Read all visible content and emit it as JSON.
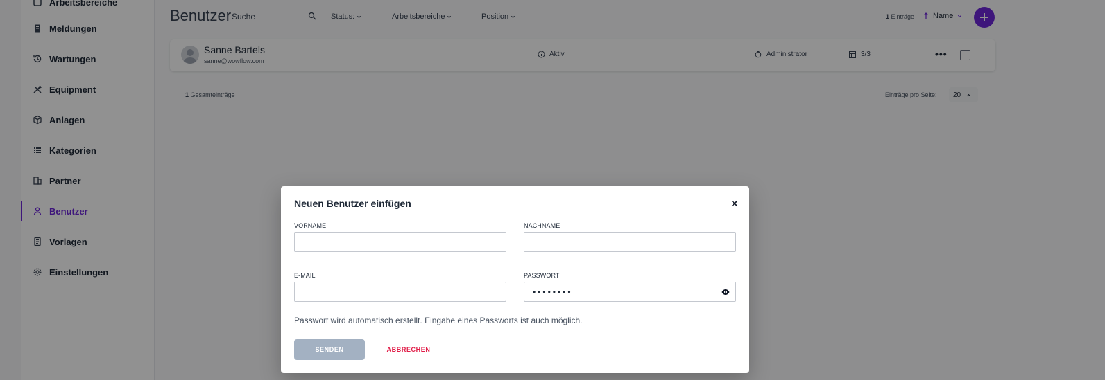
{
  "sidebar": {
    "items": [
      {
        "label": "Arbeitsbereiche",
        "icon": "workspace-icon"
      },
      {
        "label": "Meldungen",
        "icon": "report-icon"
      },
      {
        "label": "Wartungen",
        "icon": "history-icon"
      },
      {
        "label": "Equipment",
        "icon": "tools-icon"
      },
      {
        "label": "Anlagen",
        "icon": "cube-icon"
      },
      {
        "label": "Kategorien",
        "icon": "list-icon"
      },
      {
        "label": "Partner",
        "icon": "building-icon"
      },
      {
        "label": "Benutzer",
        "icon": "user-icon",
        "active": true
      },
      {
        "label": "Vorlagen",
        "icon": "document-icon"
      },
      {
        "label": "Einstellungen",
        "icon": "gear-icon"
      }
    ]
  },
  "header": {
    "title": "Benutzer",
    "search_placeholder": "Suche",
    "filters": {
      "status": "Status:",
      "areas": "Arbeitsbereiche",
      "position": "Position"
    },
    "count_number": "1",
    "count_label": "Einträge",
    "sort_label": "Name"
  },
  "user_row": {
    "name": "Sanne Bartels",
    "email": "sanne@wowflow.com",
    "status": "Aktiv",
    "role": "Administrator",
    "areas": "3/3"
  },
  "footer": {
    "total_number": "1",
    "total_label": "Gesamteinträge",
    "per_page_label": "Einträge pro Seite:",
    "per_page_value": "20"
  },
  "modal": {
    "title": "Neuen Benutzer einfügen",
    "first_name_label": "VORNAME",
    "first_name_value": "",
    "last_name_label": "NACHNAME",
    "last_name_value": "",
    "email_label": "E-MAIL",
    "email_value": "",
    "password_label": "PASSWORT",
    "password_masked": "••••••••",
    "hint": "Passwort wird automatisch erstellt. Eingabe eines Passworts ist auch möglich.",
    "send_label": "SENDEN",
    "cancel_label": "ABBRECHEN"
  },
  "colors": {
    "accent": "#6d28d9",
    "cancel": "#e11d48",
    "send_disabled": "#a3b1c2"
  }
}
